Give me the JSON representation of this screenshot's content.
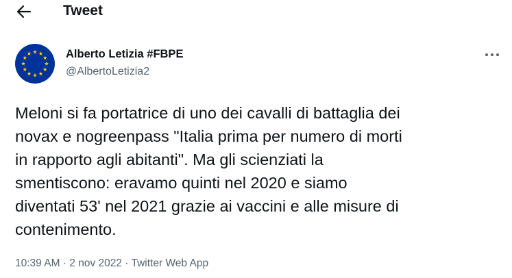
{
  "header": {
    "back_icon": "arrow-left-icon",
    "title": "Tweet"
  },
  "author": {
    "avatar_icon": "eu-flag-icon",
    "name": "Alberto Letizia #FBPE",
    "handle": "@AlbertoLetizia2",
    "more_icon": "more-horizontal-icon"
  },
  "tweet": {
    "text": "Meloni si fa portatrice di uno dei cavalli di battaglia dei\nnovax e nogreenpass \"Italia prima per numero di morti\nin rapporto agli abitanti\". Ma gli scienziati la\nsmentiscono: eravamo quinti nel 2020 e siamo\ndiventati 53' nel 2021 grazie ai vaccini e alle misure di\ncontenimento."
  },
  "meta": {
    "time": "10:39 AM",
    "separator": " · ",
    "date": "2 nov 2022",
    "source": "Twitter Web App"
  },
  "colors": {
    "text_primary": "#0f1419",
    "text_secondary": "#536471",
    "eu_blue": "#003399",
    "eu_gold": "#ffcc00"
  }
}
